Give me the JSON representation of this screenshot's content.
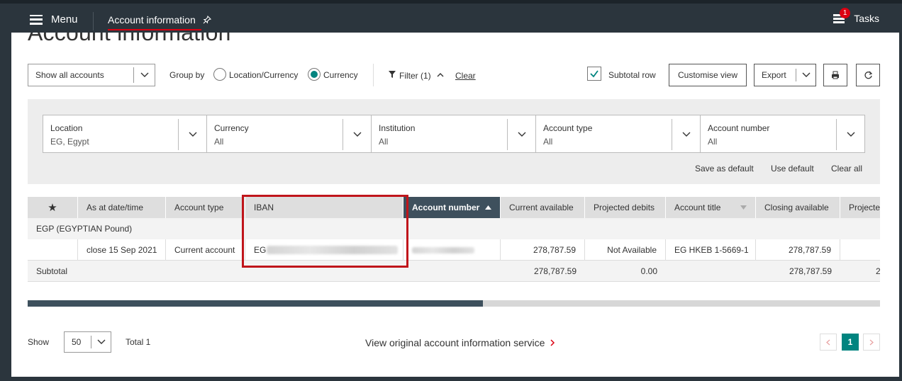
{
  "topbar": {
    "menu_label": "Menu",
    "tab_label": "Account information",
    "tasks_label": "Tasks",
    "tasks_badge": "1"
  },
  "page": {
    "title": "Account information"
  },
  "controls": {
    "accounts_select": "Show all accounts",
    "group_by_label": "Group by",
    "radio_location_currency": "Location/Currency",
    "radio_currency": "Currency",
    "group_by_selected": "Currency",
    "filter_label": "Filter (1)",
    "clear_label": "Clear",
    "subtotal_row_label": "Subtotal row",
    "subtotal_row_checked": true,
    "customise_view_label": "Customise view",
    "export_label": "Export"
  },
  "filters": [
    {
      "title": "Location",
      "value": "EG, Egypt"
    },
    {
      "title": "Currency",
      "value": "All"
    },
    {
      "title": "Institution",
      "value": "All"
    },
    {
      "title": "Account type",
      "value": "All"
    },
    {
      "title": "Account number",
      "value": "All"
    }
  ],
  "filter_actions": {
    "save_default": "Save as default",
    "use_default": "Use default",
    "clear_all": "Clear all"
  },
  "table": {
    "columns": [
      "★",
      "As at date/time",
      "Account type",
      "IBAN",
      "Account number",
      "Current available",
      "Projected debits",
      "Account title",
      "Closing available",
      "Projecte"
    ],
    "sorted_column": "Account number",
    "group": "EGP (EGYPTIAN Pound)",
    "rows": [
      {
        "as_at": "close 15 Sep 2021",
        "account_type": "Current account",
        "iban_prefix": "EG",
        "current_available": "278,787.59",
        "projected_debits": "Not Available",
        "account_title": "EG HKEB 1-5669-1",
        "closing_available": "278,787.59"
      }
    ],
    "subtotal": {
      "label": "Subtotal",
      "current_available": "278,787.59",
      "projected_debits": "0.00",
      "closing_available": "278,787.59",
      "cut_value": "2"
    }
  },
  "footer": {
    "show_label": "Show",
    "page_size": "50",
    "total_label": "Total 1",
    "view_original_link": "View original account information service",
    "current_page": "1"
  }
}
